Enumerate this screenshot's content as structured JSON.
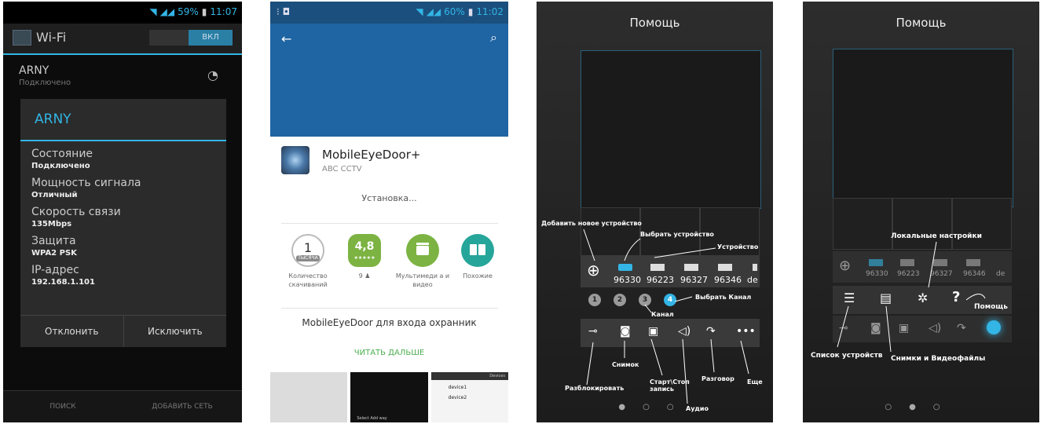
{
  "screen1": {
    "status": {
      "battery": "59%",
      "time": "11:07"
    },
    "title": "Wi-Fi",
    "toggle": "ВКЛ",
    "network": {
      "name": "ARNY",
      "status": "Подключено"
    },
    "dialog": {
      "title": "ARNY",
      "rows": [
        {
          "label": "Состояние",
          "value": "Подключено"
        },
        {
          "label": "Мощность сигнала",
          "value": "Отличный"
        },
        {
          "label": "Скорость связи",
          "value": "135Mbps"
        },
        {
          "label": "Защита",
          "value": "WPA2 PSK"
        },
        {
          "label": "IP-адрес",
          "value": "192.168.1.101"
        }
      ],
      "buttons": [
        "Отклонить",
        "Исключить"
      ]
    },
    "bottom": [
      "ПОИСК",
      "ДОБАВИТЬ СЕТЬ"
    ],
    "colors": {
      "accent": "#33b5e5"
    }
  },
  "screen2": {
    "status": {
      "battery": "60%",
      "time": "11:02"
    },
    "app": {
      "name": "MobileEyeDoor+",
      "developer": "ABC CCTV",
      "status": "Установка..."
    },
    "stats": [
      {
        "value": "1",
        "badge": "ТЫСЯЧА",
        "caption": "Количество скачиваний"
      },
      {
        "value": "4,8",
        "stars": "★★★★★",
        "caption": "9 ♟"
      },
      {
        "icon": "clapper-icon",
        "caption": "Мультимеди а и видео"
      },
      {
        "icon": "cards-icon",
        "caption": "Похожие"
      }
    ],
    "description": "MobileEyeDoor для входа охранник",
    "read_more": "ЧИТАТЬ ДАЛЬШЕ",
    "shot3": {
      "header": "Devices",
      "items": [
        "device1",
        "device2"
      ]
    },
    "shot2_text": "Select Add way",
    "colors": {
      "header": "#1f64a3",
      "green": "#4caf50"
    }
  },
  "screen3": {
    "title": "Помощь",
    "devices": [
      "96330",
      "96223",
      "96327",
      "96346",
      "de"
    ],
    "channels": [
      "1",
      "2",
      "3",
      "4"
    ],
    "annotations": {
      "add_device": "Добавить новое устройство",
      "select_device": "Выбрать устройство",
      "device": "Устройство",
      "select_channel": "Выбрать Канал",
      "channel": "Канал",
      "unlock": "Разблокировать",
      "snapshot": "Снимок",
      "start_stop": "Старт\\Стоп запись",
      "audio": "Аудио",
      "talk": "Разговор",
      "more": "Еще"
    }
  },
  "screen4": {
    "title": "Помощь",
    "devices": [
      "96330",
      "96223",
      "96327",
      "96346",
      "de"
    ],
    "annotations": {
      "local_settings": "Локальные настройки",
      "help": "Помощь",
      "device_list": "Список устройств",
      "media": "Снимки и Видеофайлы"
    }
  }
}
